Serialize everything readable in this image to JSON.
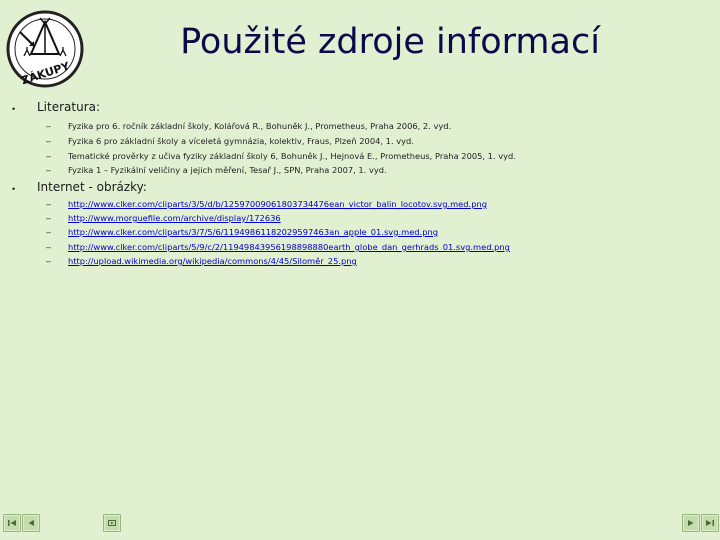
{
  "slide": {
    "title": "Použité zdroje informací",
    "logo": {
      "icon": "zakupy-coat-of-arms-icon",
      "text": "ZÁKUPY"
    },
    "sections": [
      {
        "heading": "Literatura:",
        "items": [
          "Fyzika pro 6. ročník základní školy, Kolářová R., Bohuněk J., Prometheus, Praha 2006, 2. vyd.",
          "Fyzika 6 pro základní školy a víceletá gymnázia, kolektiv, Fraus, Plzeň 2004, 1. vyd.",
          "Tematické prověrky z učiva fyziky základní školy 6, Bohuněk J., Hejnová E., Prometheus, Praha 2005, 1. vyd.",
          "Fyzika 1 – Fyzikální veličiny a jejich měření, Tesař J., SPN, Praha 2007, 1. vyd."
        ]
      },
      {
        "heading": "Internet - obrázky:",
        "links": [
          "http://www.clker.com/cliparts/3/5/d/b/12597009061803734476ean_victor_balin_locotov.svg.med.png",
          "http://www.morguefile.com/archive/display/172636",
          "http://www.clker.com/cliparts/3/7/5/6/11949861182029597463an_apple_01.svg.med.png",
          "http://www.clker.com/cliparts/5/9/c/2/11949843956198898880earth_globe_dan_gerhrads_01.svg.med.png",
          "http://upload.wikimedia.org/wikipedia/commons/4/45/Siloměr_25.png"
        ]
      }
    ]
  },
  "navigation": [
    {
      "icon": "first-slide-icon"
    },
    {
      "icon": "previous-slide-icon"
    },
    {
      "icon": "play-media-icon"
    },
    {
      "icon": "next-slide-icon"
    },
    {
      "icon": "last-slide-icon"
    }
  ],
  "colors": {
    "background": "#e2f0d2",
    "title": "#0a0a4a",
    "link": "#0000cc",
    "nav_button": "#c5dcae"
  }
}
